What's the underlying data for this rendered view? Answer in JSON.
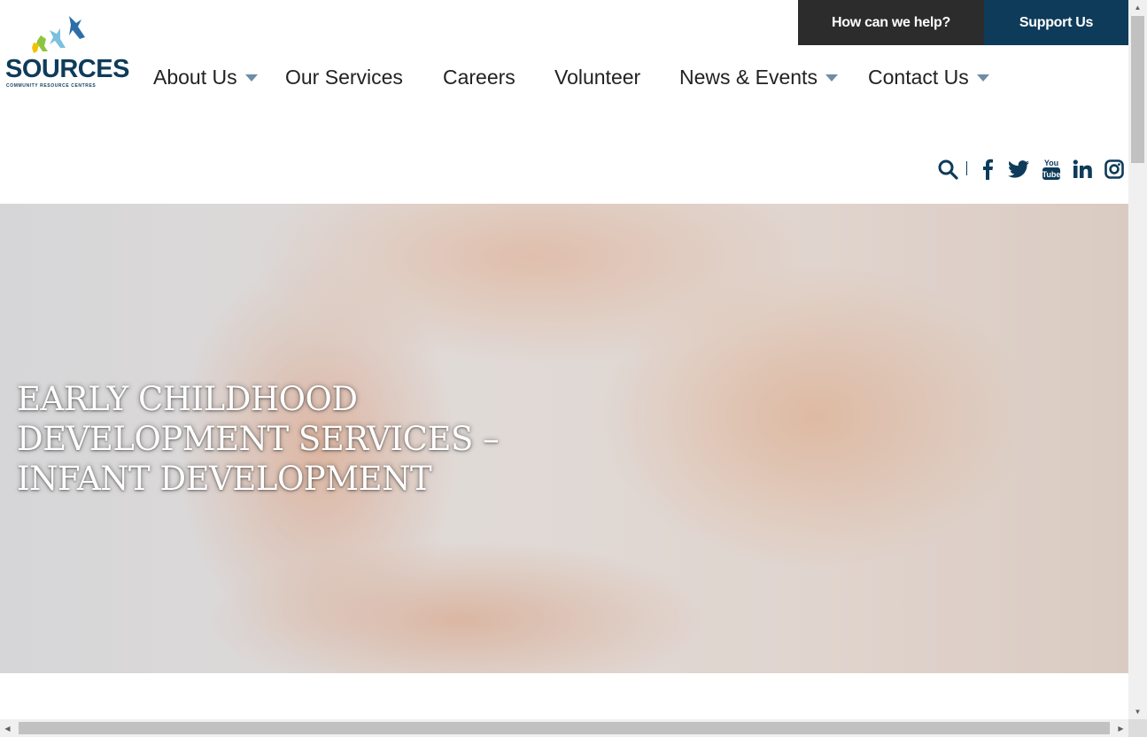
{
  "header": {
    "logo": {
      "wordmark": "SOURCES",
      "tagline": "COMMUNITY RESOURCE CENTRES",
      "colors": [
        "#0e3b5a",
        "#4f9ec8",
        "#8cc63f",
        "#f2c200"
      ]
    },
    "utility": {
      "help_label": "How can we help?",
      "support_label": "Support Us"
    },
    "nav": [
      {
        "label": "About Us",
        "has_dropdown": true
      },
      {
        "label": "Our Services",
        "has_dropdown": false
      },
      {
        "label": "Careers",
        "has_dropdown": false
      },
      {
        "label": "Volunteer",
        "has_dropdown": false
      },
      {
        "label": "News & Events",
        "has_dropdown": true
      },
      {
        "label": "Contact Us",
        "has_dropdown": true
      }
    ],
    "social_icons": [
      "search-icon",
      "facebook-icon",
      "twitter-icon",
      "youtube-icon",
      "linkedin-icon",
      "instagram-icon"
    ]
  },
  "hero": {
    "title_lines": [
      "EARLY CHILDHOOD",
      "DEVELOPMENT SERVICES –",
      "INFANT DEVELOPMENT"
    ]
  },
  "colors": {
    "brand_navy": "#0e3b5a",
    "help_bg": "#2c2c2c",
    "caret": "#6d8da6"
  }
}
